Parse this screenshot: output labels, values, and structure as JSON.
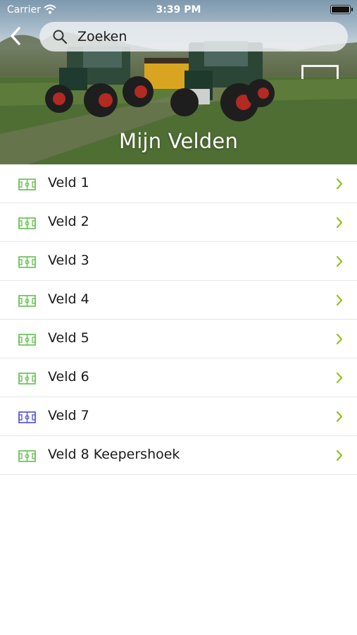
{
  "status_bar": {
    "carrier": "Carrier",
    "time": "3:39 PM"
  },
  "nav": {
    "back_icon": "chevron-left-icon",
    "search_placeholder": "Zoeken",
    "search_icon": "search-icon"
  },
  "header": {
    "title": "Mijn Velden"
  },
  "colors": {
    "accent": "#8fc31f",
    "field_icon_default": "#5fbf4a",
    "field_icon_highlight": "#4a4fd6",
    "divider": "#e6e6e6"
  },
  "fields": [
    {
      "label": "Veld 1",
      "icon": "field-icon",
      "icon_color": "#5fbf4a"
    },
    {
      "label": "Veld 2",
      "icon": "field-icon",
      "icon_color": "#5fbf4a"
    },
    {
      "label": "Veld 3",
      "icon": "field-icon",
      "icon_color": "#5fbf4a"
    },
    {
      "label": "Veld 4",
      "icon": "field-icon",
      "icon_color": "#5fbf4a"
    },
    {
      "label": "Veld 5",
      "icon": "field-icon",
      "icon_color": "#5fbf4a"
    },
    {
      "label": "Veld 6",
      "icon": "field-icon",
      "icon_color": "#5fbf4a"
    },
    {
      "label": "Veld 7",
      "icon": "field-icon",
      "icon_color": "#4a4fd6"
    },
    {
      "label": "Veld 8 Keepershoek",
      "icon": "field-icon",
      "icon_color": "#5fbf4a"
    }
  ]
}
